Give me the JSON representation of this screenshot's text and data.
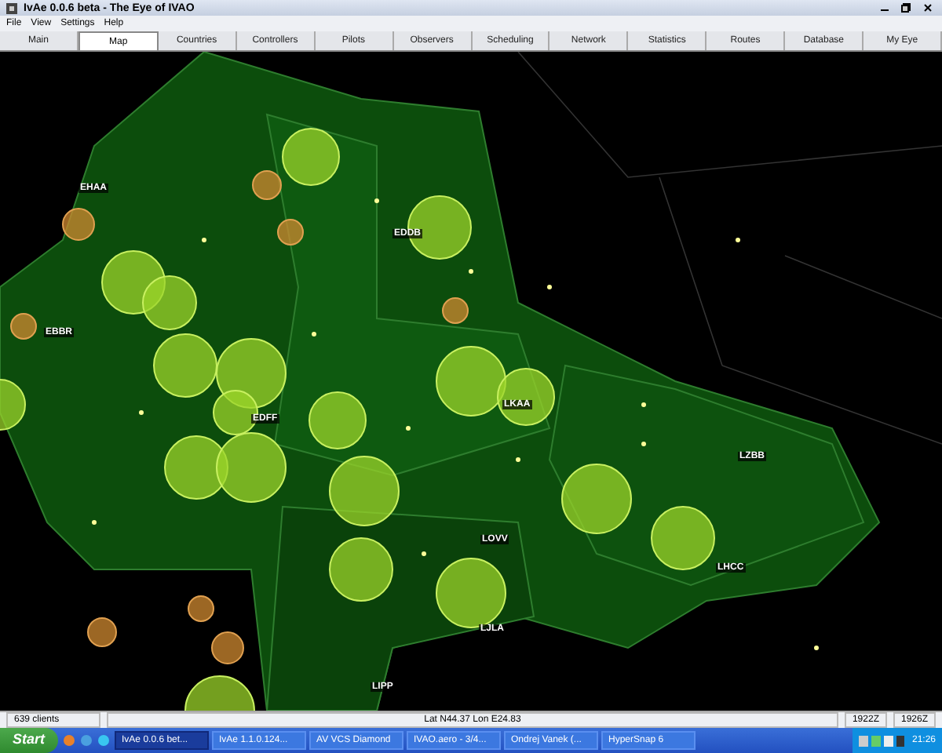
{
  "window": {
    "title": "IvAe 0.0.6 beta - The Eye of IVAO"
  },
  "menu": [
    "File",
    "View",
    "Settings",
    "Help"
  ],
  "tabs": [
    {
      "label": "Main",
      "selected": false
    },
    {
      "label": "Map",
      "selected": true
    },
    {
      "label": "Countries",
      "selected": false
    },
    {
      "label": "Controllers",
      "selected": false
    },
    {
      "label": "Pilots",
      "selected": false
    },
    {
      "label": "Observers",
      "selected": false
    },
    {
      "label": "Scheduling",
      "selected": false
    },
    {
      "label": "Network",
      "selected": false
    },
    {
      "label": "Statistics",
      "selected": false
    },
    {
      "label": "Routes",
      "selected": false
    },
    {
      "label": "Database",
      "selected": false
    },
    {
      "label": "My Eye",
      "selected": false
    }
  ],
  "map_labels": [
    "EHAA",
    "EBBR",
    "EDFF",
    "EDDB",
    "LKAA",
    "LOVV",
    "LZBB",
    "LHCC",
    "LJLA",
    "LIPP"
  ],
  "status_bar": {
    "clients": "639 clients",
    "position": "Lat N44.37 Lon E24.83",
    "time_1": "1922Z",
    "time_2": "1926Z"
  },
  "taskbar": {
    "start": "Start",
    "tasks": [
      {
        "label": "IvAe 0.0.6 bet...",
        "selected": true
      },
      {
        "label": "IvAe 1.1.0.124...",
        "selected": false
      },
      {
        "label": "AV VCS Diamond",
        "selected": false
      },
      {
        "label": "IVAO.aero - 3/4...",
        "selected": false
      },
      {
        "label": "Ondrej Vanek (...",
        "selected": false
      },
      {
        "label": "HyperSnap 6",
        "selected": false
      }
    ],
    "clock": "21:26"
  }
}
